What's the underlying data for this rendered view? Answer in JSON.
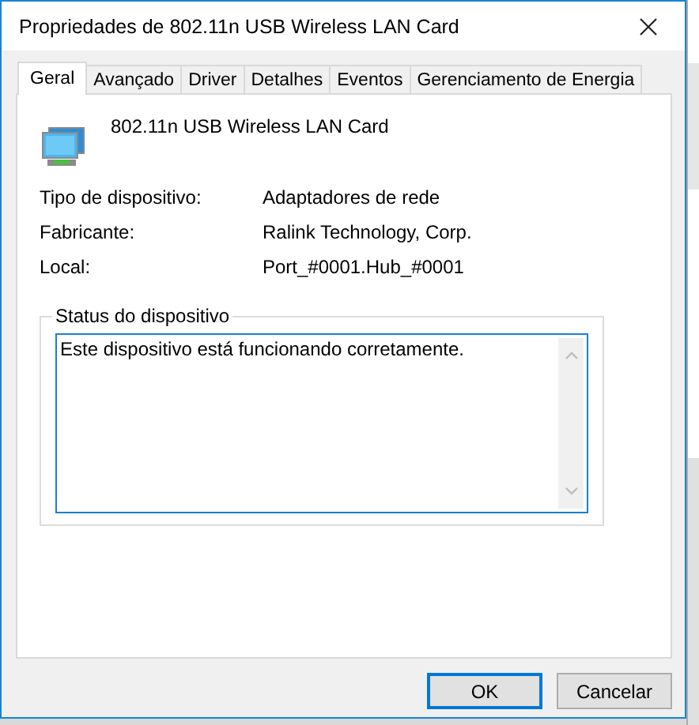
{
  "window": {
    "title": "Propriedades de 802.11n USB Wireless LAN Card"
  },
  "tabs": [
    {
      "label": "Geral",
      "selected": true
    },
    {
      "label": "Avançado",
      "selected": false
    },
    {
      "label": "Driver",
      "selected": false
    },
    {
      "label": "Detalhes",
      "selected": false
    },
    {
      "label": "Eventos",
      "selected": false
    },
    {
      "label": "Gerenciamento de Energia",
      "selected": false
    }
  ],
  "device": {
    "name": "802.11n USB Wireless LAN Card"
  },
  "properties": [
    {
      "label": "Tipo de dispositivo:",
      "value": "Adaptadores de rede"
    },
    {
      "label": "Fabricante:",
      "value": "Ralink Technology, Corp."
    },
    {
      "label": "Local:",
      "value": "Port_#0001.Hub_#0001"
    }
  ],
  "status": {
    "title": "Status do dispositivo",
    "text": "Este dispositivo está funcionando corretamente."
  },
  "buttons": [
    {
      "label": "OK",
      "selected": true
    },
    {
      "label": "Cancelar",
      "selected": false
    }
  ]
}
